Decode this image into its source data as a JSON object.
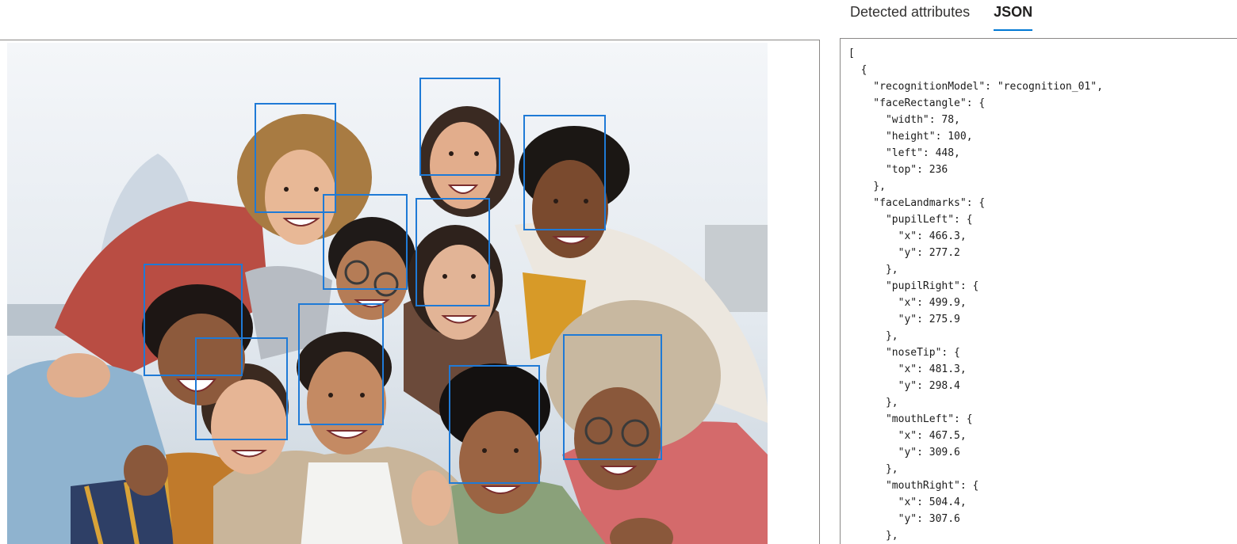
{
  "tabs": {
    "detected_attributes": "Detected attributes",
    "json": "JSON",
    "active": "JSON"
  },
  "colors": {
    "accent": "#0078d4",
    "face_box": "#1f7ad6",
    "border": "#8a8886"
  },
  "image": {
    "description_icon": "group-photo",
    "faces_detected": 10
  },
  "json_lines": [
    "[",
    "  {",
    "    \"recognitionModel\": \"recognition_01\",",
    "    \"faceRectangle\": {",
    "      \"width\": 78,",
    "      \"height\": 100,",
    "      \"left\": 448,",
    "      \"top\": 236",
    "    },",
    "    \"faceLandmarks\": {",
    "      \"pupilLeft\": {",
    "        \"x\": 466.3,",
    "        \"y\": 277.2",
    "      },",
    "      \"pupilRight\": {",
    "        \"x\": 499.9,",
    "        \"y\": 275.9",
    "      },",
    "      \"noseTip\": {",
    "        \"x\": 481.3,",
    "        \"y\": 298.4",
    "      },",
    "      \"mouthLeft\": {",
    "        \"x\": 467.5,",
    "        \"y\": 309.6",
    "      },",
    "      \"mouthRight\": {",
    "        \"x\": 504.4,",
    "        \"y\": 307.6",
    "      },"
  ]
}
